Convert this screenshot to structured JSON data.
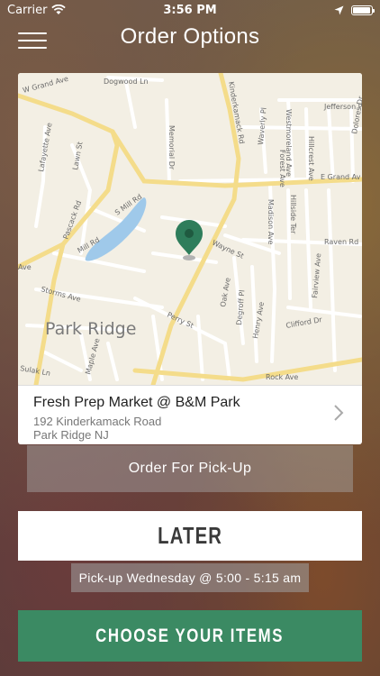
{
  "status_bar": {
    "carrier": "Carrier",
    "time": "3:56 PM"
  },
  "nav": {
    "title": "Order Options",
    "menu_icon": "hamburger-menu-icon"
  },
  "map": {
    "town_label": "Park Ridge",
    "streets": [
      "W Grand Ave",
      "Dogwood Ln",
      "Kinderkamack Rd",
      "Jefferson Pl",
      "Westmoreland Ave",
      "Memorial Dr",
      "Lafayette Ave",
      "Lawn St",
      "Waverly Pl",
      "Forest Ave",
      "Hillcrest Ave",
      "Dolores Dr",
      "E Grand Av",
      "Pascack Rd",
      "S Mill Rd",
      "Mill Rd",
      "Madison Ave",
      "Hillside Ter",
      "Raven Rd",
      "Wayne St",
      "Fairview Ave",
      "Ave",
      "Storms Ave",
      "Oak Ave",
      "Degroff Pl",
      "Henry Ave",
      "Perry St",
      "Clifford Dr",
      "Maple Ave",
      "Sulak Ln",
      "Rock Ave"
    ],
    "pin_color": "#2e7d5b"
  },
  "location": {
    "name": "Fresh Prep Market @ B&M Park",
    "address_line1": "192 Kinderkamack Road",
    "address_line2": "Park Ridge NJ"
  },
  "order_type": {
    "label": "Order For Pick-Up"
  },
  "schedule": {
    "button_label": "LATER",
    "pickup_text": "Pick-up Wednesday @ 5:00 - 5:15 am"
  },
  "cta": {
    "label": "CHOOSE YOUR ITEMS",
    "color": "#3b8a63"
  }
}
